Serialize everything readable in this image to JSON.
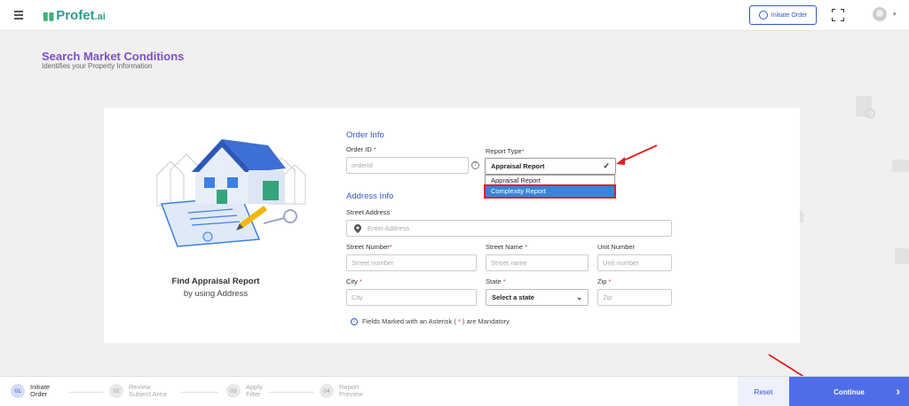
{
  "header": {
    "logo_text": "Profet",
    "logo_suffix": ".ai",
    "initiate_label": "Initiate Order"
  },
  "page": {
    "title": "Search Market Conditions",
    "subtitle": "Identifies your Property Information"
  },
  "left_panel": {
    "title": "Find Appraisal Report",
    "subtitle": "by using Address"
  },
  "order_info": {
    "section_title": "Order Info",
    "order_id_label": "Order ID",
    "order_id_placeholder": "orderId",
    "report_type_label": "Report Type",
    "report_type_value": "Appraisal Report",
    "report_type_options": [
      "Appraisal Report",
      "Complexity Report"
    ]
  },
  "address_info": {
    "section_title": "Address Info",
    "street_address_label": "Street Address",
    "street_address_placeholder": "Enter Address",
    "street_number_label": "Street Number",
    "street_number_placeholder": "Street number",
    "street_name_label": "Street Name",
    "street_name_placeholder": "Street name",
    "unit_number_label": "Unit Number",
    "unit_number_placeholder": "Unit number",
    "city_label": "City",
    "city_placeholder": "City",
    "state_label": "State",
    "state_value": "Select a state",
    "zip_label": "Zip",
    "zip_placeholder": "Zip"
  },
  "note": {
    "prefix": "Fields Marked with an Asterisk (",
    "star": " * ",
    "suffix": ") are Mandatory"
  },
  "steps": [
    {
      "num": "01",
      "line1": "Initiate",
      "line2": "Order"
    },
    {
      "num": "02",
      "line1": "Review",
      "line2": "Subject Area"
    },
    {
      "num": "03",
      "line1": "Apply",
      "line2": "Filter"
    },
    {
      "num": "04",
      "line1": "Report",
      "line2": "Preview"
    }
  ],
  "actions": {
    "reset_label": "Reset",
    "continue_label": "Continue"
  },
  "colors": {
    "accent": "#3557c6",
    "title": "#7b4fc7",
    "continue_bg": "#4f6ee6",
    "highlight_red": "#e02020"
  }
}
